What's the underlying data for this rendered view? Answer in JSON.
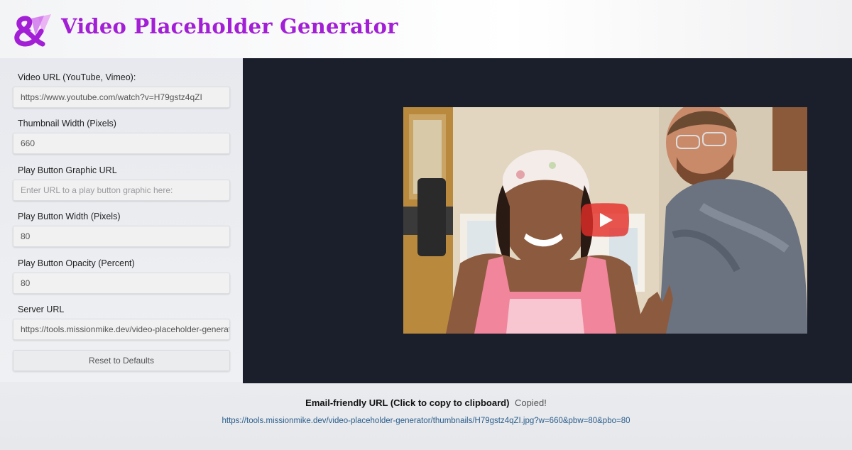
{
  "app": {
    "title": "Video Placeholder Generator",
    "logo_icon": "ampersand-logo-icon",
    "accent_color": "#a21fd6"
  },
  "form": {
    "video_url": {
      "label": "Video URL (YouTube, Vimeo):",
      "value": "https://www.youtube.com/watch?v=H79gstz4qZI"
    },
    "thumb_width": {
      "label": "Thumbnail Width (Pixels)",
      "value": "660"
    },
    "play_url": {
      "label": "Play Button Graphic URL",
      "value": "",
      "placeholder": "Enter URL to a play button graphic here:"
    },
    "play_width": {
      "label": "Play Button Width (Pixels)",
      "value": "80"
    },
    "play_opacity": {
      "label": "Play Button Opacity (Percent)",
      "value": "80"
    },
    "server_url": {
      "label": "Server URL",
      "value": "https://tools.missionmike.dev/video-placeholder-generator"
    },
    "reset_label": "Reset to Defaults"
  },
  "preview": {
    "background": "#1b1f2b",
    "play_icon": "youtube-play-icon",
    "play_color": "#e52d27"
  },
  "result": {
    "heading": "Email-friendly URL (Click to copy to clipboard)",
    "status": "Copied!",
    "url": "https://tools.missionmike.dev/video-placeholder-generator/thumbnails/H79gstz4qZI.jpg?w=660&pbw=80&pbo=80"
  }
}
